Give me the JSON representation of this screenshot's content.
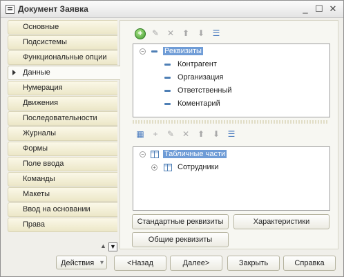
{
  "window": {
    "title": "Документ Заявка",
    "controls": {
      "minimize": "_",
      "maximize": "☐",
      "close": "✕"
    }
  },
  "nav": {
    "items": [
      {
        "label": "Основные"
      },
      {
        "label": "Подсистемы"
      },
      {
        "label": "Функциональные опции"
      },
      {
        "label": "Данные",
        "active": true
      },
      {
        "label": "Нумерация"
      },
      {
        "label": "Движения"
      },
      {
        "label": "Последовательности"
      },
      {
        "label": "Журналы"
      },
      {
        "label": "Формы"
      },
      {
        "label": "Поле ввода"
      },
      {
        "label": "Команды"
      },
      {
        "label": "Макеты"
      },
      {
        "label": "Ввод на основании"
      },
      {
        "label": "Права"
      }
    ],
    "scroll_up": "▲",
    "scroll_down": "▼"
  },
  "requisites": {
    "toolbar": {
      "add_icon": "+",
      "edit_icon": "✎",
      "delete_icon": "✕",
      "move_up_icon": "⬆",
      "move_down_icon": "⬇",
      "sort_icon": "☰"
    },
    "root": {
      "label": "Реквизиты",
      "expander": "−"
    },
    "children": [
      {
        "label": "Контрагент"
      },
      {
        "label": "Организация"
      },
      {
        "label": "Ответственный"
      },
      {
        "label": "Коментарий"
      }
    ]
  },
  "tabular": {
    "toolbar": {
      "add_table_icon": "▦",
      "add_attribute_icon": "+",
      "edit_icon": "✎",
      "delete_icon": "✕",
      "move_up_icon": "⬆",
      "move_down_icon": "⬇",
      "sort_icon": "☰"
    },
    "root": {
      "label": "Табличные части",
      "expander": "−"
    },
    "children": [
      {
        "label": "Сотрудники",
        "expander": "+"
      }
    ]
  },
  "buttons": {
    "standard_requisites": "Стандартные реквизиты",
    "characteristics": "Характеристики",
    "common_requisites": "Общие реквизиты",
    "actions": "Действия",
    "back": "<Назад",
    "next": "Далее>",
    "close": "Закрыть",
    "help": "Справка"
  }
}
